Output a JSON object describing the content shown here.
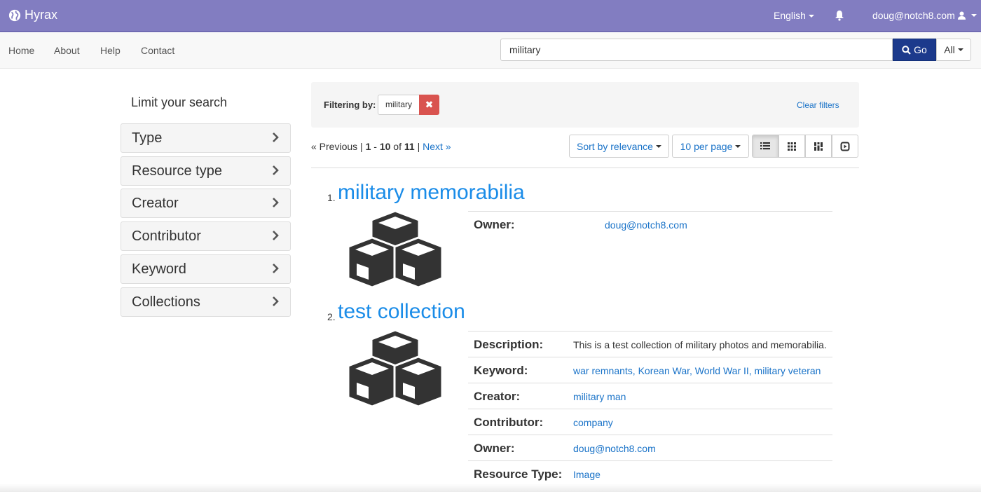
{
  "brand": {
    "name": "Hyrax",
    "icon": "globe-icon"
  },
  "topbar": {
    "language": "English",
    "notifications_icon": "bell-icon",
    "user": "doug@notch8.com",
    "user_icon": "user-icon"
  },
  "nav": {
    "items": [
      "Home",
      "About",
      "Help",
      "Contact"
    ]
  },
  "search": {
    "value": "military",
    "go_label": "Go",
    "scope_label": "All"
  },
  "sidebar": {
    "title": "Limit your search",
    "facets": [
      "Type",
      "Resource type",
      "Creator",
      "Contributor",
      "Keyword",
      "Collections"
    ]
  },
  "constraints": {
    "label": "Filtering by:",
    "value": "military",
    "remove_label": "✖",
    "clear_label": "Clear filters"
  },
  "pagination": {
    "previous": "« Previous",
    "range_start": "1",
    "range_end": "10",
    "total": "11",
    "next": "Next »",
    "sep": "|",
    "dash": "-",
    "of": "of"
  },
  "sort": {
    "sort_label": "Sort by relevance",
    "per_page_label": "10 per page",
    "views": [
      "list-view-icon",
      "gallery-view-icon",
      "masonry-view-icon",
      "slideshow-view-icon"
    ]
  },
  "results": [
    {
      "num": "1.",
      "title": "military memorabilia",
      "thumb_icon": "cubes-icon",
      "fields": [
        {
          "key": "Owner:",
          "value": "doug@notch8.com",
          "link": true
        }
      ]
    },
    {
      "num": "2.",
      "title": "test collection",
      "thumb_icon": "cubes-icon",
      "fields": [
        {
          "key": "Description:",
          "value": "This is a test collection of military photos and memorabilia.",
          "link": false
        },
        {
          "key": "Keyword:",
          "value": "war remnants, Korean War, World War II, military veteran",
          "link": true
        },
        {
          "key": "Creator:",
          "value": "military man",
          "link": true
        },
        {
          "key": "Contributor:",
          "value": "company",
          "link": true
        },
        {
          "key": "Owner:",
          "value": "doug@notch8.com",
          "link": true
        },
        {
          "key": "Resource Type:",
          "value": "Image",
          "link": true
        }
      ]
    }
  ]
}
